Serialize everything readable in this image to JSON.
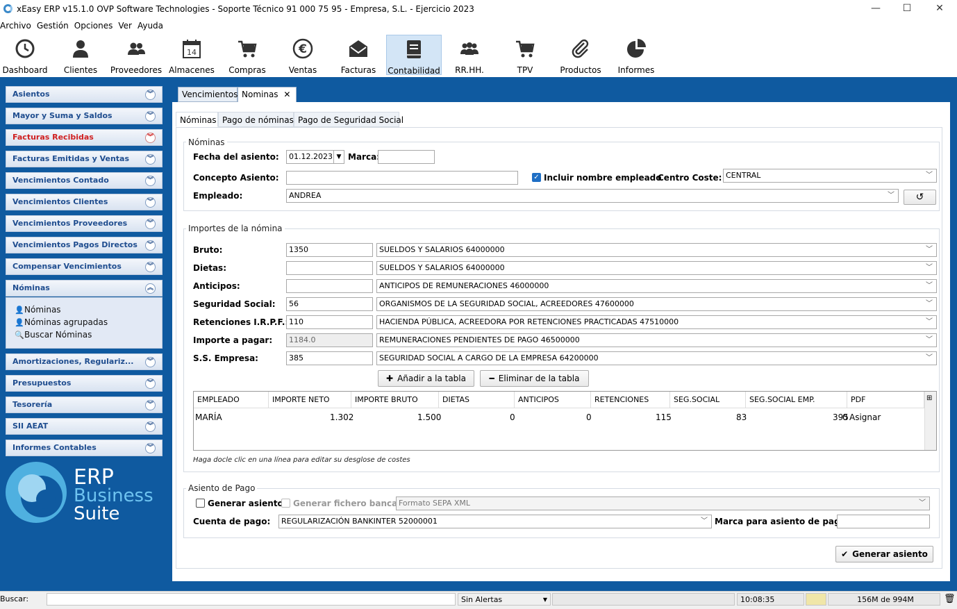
{
  "window": {
    "title": "xEasy ERP v15.1.0 OVP Software Technologies - Soporte Técnico 91 000 75 95 - Empresa, S.L. - Ejercicio 2023",
    "minimize": "—",
    "maximize": "☐",
    "close": "✕"
  },
  "menu": [
    "Archivo",
    "Gestión",
    "Opciones",
    "Ver",
    "Ayuda"
  ],
  "toolbar": [
    {
      "label": "Dashboard",
      "icon": "clock-icon"
    },
    {
      "label": "Clientes",
      "icon": "person-icon"
    },
    {
      "label": "Proveedores",
      "icon": "people-icon"
    },
    {
      "label": "Almacenes",
      "icon": "calendar-icon",
      "glyph": "14"
    },
    {
      "label": "Compras",
      "icon": "cart-icon"
    },
    {
      "label": "Ventas",
      "icon": "euro-icon",
      "glyph": "€"
    },
    {
      "label": "Facturas",
      "icon": "envelope-icon"
    },
    {
      "label": "Contabilidad",
      "icon": "ledger-icon",
      "active": true
    },
    {
      "label": "RR.HH.",
      "icon": "group-icon"
    },
    {
      "label": "TPV",
      "icon": "pos-cart-icon"
    },
    {
      "label": "Productos",
      "icon": "paperclip-icon"
    },
    {
      "label": "Informes",
      "icon": "pie-chart-icon"
    }
  ],
  "sidebar": {
    "items": [
      {
        "label": "Asientos"
      },
      {
        "label": "Mayor y Suma y Saldos"
      },
      {
        "label": "Facturas Recibidas",
        "highlight": true
      },
      {
        "label": "Facturas Emitidas y Ventas"
      },
      {
        "label": "Vencimientos Contado"
      },
      {
        "label": "Vencimientos Clientes"
      },
      {
        "label": "Vencimientos Proveedores"
      },
      {
        "label": "Vencimientos Pagos Directos"
      },
      {
        "label": "Compensar Vencimientos"
      },
      {
        "label": "Nóminas",
        "expanded": true
      },
      {
        "label": "Amortizaciones, Regulariz..."
      },
      {
        "label": "Presupuestos"
      },
      {
        "label": "Tesorería"
      },
      {
        "label": "SII AEAT"
      },
      {
        "label": "Informes Contables"
      }
    ],
    "nominas_sub": [
      {
        "label": "Nóminas",
        "icon": "person-icon"
      },
      {
        "label": "Nóminas agrupadas",
        "icon": "person-icon"
      },
      {
        "label": "Buscar Nóminas",
        "icon": "search-icon"
      }
    ],
    "logo": {
      "line1": "ERP",
      "line2": "Business",
      "line3": "Suite"
    }
  },
  "doc_tabs": [
    {
      "label": "Vencimientos"
    },
    {
      "label": "Nominas",
      "active": true,
      "close": "✕"
    }
  ],
  "sub_tabs": [
    {
      "label": "Nóminas",
      "active": true
    },
    {
      "label": "Pago de nóminas"
    },
    {
      "label": "Pago de Seguridad Social"
    }
  ],
  "nominas_section": {
    "legend": "Nóminas",
    "fecha_label": "Fecha del asiento:",
    "fecha_value": "01.12.2023",
    "marca_label": "Marca:",
    "marca_value": "",
    "concepto_label": "Concepto Asiento:",
    "concepto_value": "",
    "incluir_label": "Incluir nombre empleado",
    "incluir_checked": true,
    "centro_label": "Centro Coste:",
    "centro_value": "CENTRAL",
    "empleado_label": "Empleado:",
    "empleado_value": "ANDREA"
  },
  "importes_section": {
    "legend": "Importes de la nómina",
    "rows": [
      {
        "label": "Bruto:",
        "value": "1350",
        "account": "SUELDOS Y SALARIOS 64000000"
      },
      {
        "label": "Dietas:",
        "value": "",
        "account": "SUELDOS Y SALARIOS 64000000"
      },
      {
        "label": "Anticipos:",
        "value": "",
        "account": "ANTICIPOS DE REMUNERACIONES 46000000"
      },
      {
        "label": "Seguridad Social:",
        "value": "56",
        "account": "ORGANISMOS DE LA SEGURIDAD SOCIAL, ACREEDORES 47600000"
      },
      {
        "label": "Retenciones I.R.P.F.:",
        "value": "110",
        "account": "HACIENDA PÚBLICA, ACREEDORA POR RETENCIONES PRACTICADAS 47510000"
      },
      {
        "label": "Importe a pagar:",
        "value": "1184.0",
        "account": "REMUNERACIONES PENDIENTES DE PAGO 46500000",
        "disabled": true
      },
      {
        "label": "S.S. Empresa:",
        "value": "385",
        "account": "SEGURIDAD SOCIAL A CARGO DE LA EMPRESA 64200000"
      }
    ],
    "add_button": "Añadir a la tabla",
    "remove_button": "Eliminar de la tabla"
  },
  "table": {
    "headers": [
      "EMPLEADO",
      "IMPORTE NETO",
      "IMPORTE BRUTO",
      "DIETAS",
      "ANTICIPOS",
      "RETENCIONES",
      "SEG.SOCIAL",
      "SEG.SOCIAL EMP.",
      "PDF"
    ],
    "rows": [
      [
        "MARÍA",
        "1.302",
        "1.500",
        "0",
        "0",
        "115",
        "83",
        "395",
        "0",
        "Asignar"
      ]
    ],
    "hint": "Haga docle clic en una línea para editar su desglose de costes"
  },
  "pago_section": {
    "legend": "Asiento de Pago",
    "generar_label": "Generar asiento",
    "generar_checked": false,
    "fichero_label": "Generar fichero bancario",
    "fichero_checked": false,
    "formato_value": "Formato SEPA XML",
    "cuenta_label": "Cuenta de pago:",
    "cuenta_value": "REGULARIZACIÓN BANKINTER 52000001",
    "marca_pago_label": "Marca para asiento de pago",
    "marca_pago_value": ""
  },
  "generar_button": "Generar asiento",
  "statusbar": {
    "search_label": "Buscar:",
    "search_value": "",
    "alerts": "Sin Alertas",
    "time": "10:08:35",
    "memory": "156M de 994M"
  }
}
